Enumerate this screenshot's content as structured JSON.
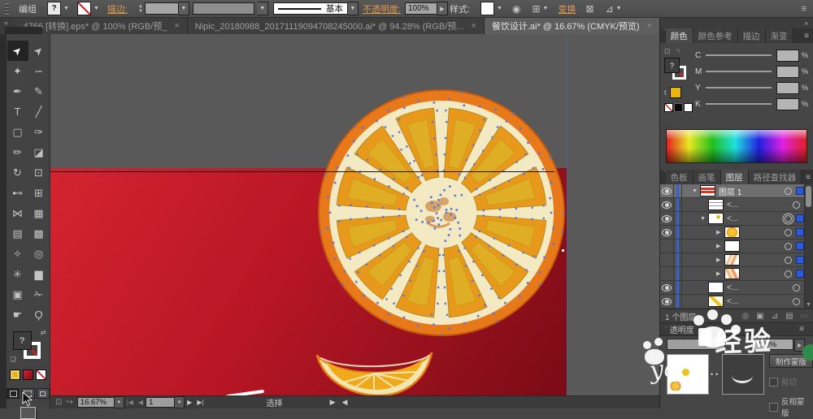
{
  "control_bar": {
    "context_label": "编组",
    "fill_unknown": "?",
    "stroke_label": "描边:",
    "brush_name": "基本",
    "opacity_label": "不透明度:",
    "opacity_value": "100%",
    "style_label": "样式:",
    "transform_label": "变换",
    "icons": {
      "recolor": "◉",
      "align": "⊞",
      "free_distort": "⊠",
      "shear": "⊿",
      "menu": "≡"
    }
  },
  "document_tabs": [
    {
      "title": "4766 [转换].eps* @ 100% (RGB/预_",
      "active": false
    },
    {
      "title": "Nipic_20180988_20171119094708245000.ai* @ 94.28% (RGB/预...",
      "active": false
    },
    {
      "title": "餐饮设计.ai* @ 16.67% (CMYK/预览)",
      "active": true
    }
  ],
  "close_glyph": "×",
  "collapse_glyph": "«",
  "toolbar": {
    "tools": [
      {
        "name": "selection-tool",
        "glyph": "➤",
        "active": true,
        "rotate": true
      },
      {
        "name": "direct-selection-tool",
        "glyph": "➤",
        "active": false,
        "rotate": true
      },
      {
        "name": "magic-wand-tool",
        "glyph": "✦"
      },
      {
        "name": "lasso-tool",
        "glyph": "∽"
      },
      {
        "name": "pen-tool",
        "glyph": "✒"
      },
      {
        "name": "curvature-tool",
        "glyph": "✎"
      },
      {
        "name": "type-tool",
        "glyph": "T"
      },
      {
        "name": "line-segment-tool",
        "glyph": "╱"
      },
      {
        "name": "rectangle-tool",
        "glyph": "▢"
      },
      {
        "name": "paintbrush-tool",
        "glyph": "✑"
      },
      {
        "name": "pencil-tool",
        "glyph": "✏"
      },
      {
        "name": "eraser-tool",
        "glyph": "◪"
      },
      {
        "name": "rotate-tool",
        "glyph": "↻"
      },
      {
        "name": "free-transform-tool",
        "glyph": "⊡"
      },
      {
        "name": "width-tool",
        "glyph": "⊷"
      },
      {
        "name": "perspective-grid-tool",
        "glyph": "⊞"
      },
      {
        "name": "shape-builder-tool",
        "glyph": "⋈"
      },
      {
        "name": "perspective-selection-tool",
        "glyph": "▦"
      },
      {
        "name": "mesh-tool",
        "glyph": "▤"
      },
      {
        "name": "gradient-tool",
        "glyph": "▩"
      },
      {
        "name": "eyedropper-tool",
        "glyph": "✧"
      },
      {
        "name": "blend-tool",
        "glyph": "◎"
      },
      {
        "name": "symbol-sprayer-tool",
        "glyph": "✳"
      },
      {
        "name": "column-graph-tool",
        "glyph": "▆"
      },
      {
        "name": "artboard-tool",
        "glyph": "▣"
      },
      {
        "name": "slice-tool",
        "glyph": "✁"
      },
      {
        "name": "hand-tool",
        "glyph": "☛"
      },
      {
        "name": "zoom-tool",
        "glyph": "Ϙ"
      }
    ],
    "fill_unknown": "?"
  },
  "color_panel": {
    "tabs": [
      {
        "label": "颜色",
        "active": true
      },
      {
        "label": "颜色参考",
        "active": false
      },
      {
        "label": "描边",
        "active": false
      },
      {
        "label": "渐变",
        "active": false
      }
    ],
    "channels": [
      "C",
      "M",
      "Y",
      "K"
    ],
    "unit": "%",
    "fill_mark": "?",
    "type_mark": "t"
  },
  "panels_row2": {
    "tabs": [
      {
        "label": "色板",
        "active": false
      },
      {
        "label": "画笔",
        "active": false
      },
      {
        "label": "图层",
        "active": true
      },
      {
        "label": "路径查找器",
        "active": false
      }
    ]
  },
  "layers_panel": {
    "rows": [
      {
        "label": "图层 1",
        "eye": true,
        "exp": "▼",
        "indent": 0,
        "thumb": "red-stripes",
        "selected": true,
        "target": "single",
        "proxy": true
      },
      {
        "label": "<...",
        "eye": true,
        "exp": "",
        "indent": 1,
        "thumb": "white-lines",
        "selected": false,
        "target": "single",
        "proxy": false
      },
      {
        "label": "<...",
        "eye": true,
        "exp": "▼",
        "indent": 1,
        "thumb": "white-dot",
        "selected": false,
        "target": "double",
        "proxy": true
      },
      {
        "label": "",
        "eye": true,
        "exp": "▶",
        "indent": 3,
        "thumb": "orange-blob",
        "selected": false,
        "target": "single",
        "proxy": true
      },
      {
        "label": "",
        "eye": false,
        "exp": "▶",
        "indent": 3,
        "thumb": "white",
        "selected": false,
        "target": "single",
        "proxy": true
      },
      {
        "label": "",
        "eye": false,
        "exp": "▶",
        "indent": 3,
        "thumb": "orange-sketch",
        "selected": false,
        "target": "single",
        "proxy": true
      },
      {
        "label": "",
        "eye": false,
        "exp": "▶",
        "indent": 3,
        "thumb": "orange-sketch2",
        "selected": false,
        "target": "single",
        "proxy": true
      },
      {
        "label": "<...",
        "eye": true,
        "exp": "",
        "indent": 1,
        "thumb": "white",
        "selected": false,
        "target": "single",
        "proxy": false
      },
      {
        "label": "<...",
        "eye": true,
        "exp": "",
        "indent": 1,
        "thumb": "pencil",
        "selected": false,
        "target": "single",
        "proxy": false
      }
    ],
    "footer_count": "1 个图层",
    "footer_icons": [
      {
        "name": "locate-object-icon",
        "glyph": "◎",
        "dim": false
      },
      {
        "name": "make-clipping-mask-icon",
        "glyph": "▣",
        "dim": false
      },
      {
        "name": "new-sublayer-icon",
        "glyph": "⊿",
        "dim": false
      },
      {
        "name": "new-layer-icon",
        "glyph": "▤",
        "dim": false
      },
      {
        "name": "delete-layer-icon",
        "glyph": "▭",
        "dim": true
      }
    ]
  },
  "transparency_panel": {
    "title": "透明度",
    "opacity_value": "100%",
    "make_mask": "制作蒙版",
    "clip": "剪切",
    "invert": "反相蒙版"
  },
  "status_bar": {
    "zoom_level": "16.67%",
    "artboard_number": "1",
    "mode_label": "选择"
  },
  "watermark": {
    "brand_text": "经验",
    "script_text": "yan"
  },
  "dock_icons": {
    "collapse": "»",
    "menu": "≡",
    "tab_caret": "ˇ"
  },
  "artwork": {
    "pasteboard": "#595959",
    "artboard_red_top": "#d42331",
    "artboard_red_bottom": "#7e0c18",
    "orange_ring": "#e8791b",
    "orange_rim": "#c2590e",
    "orange_pith": "#f3e9c3",
    "orange_segment": "#e8991c",
    "orange_segment_inner": "#dfae25",
    "outline": "#b98a1a",
    "anchor_blue": "#5a79d8",
    "center_tan": "#d49a5e",
    "wedge_flesh": "#efa91b",
    "wedge_gold": "#e9b322",
    "wedge_rind": "#f3e5ae",
    "swatch_yellow": "#e8b50e",
    "swatch_red": "#d22525"
  }
}
